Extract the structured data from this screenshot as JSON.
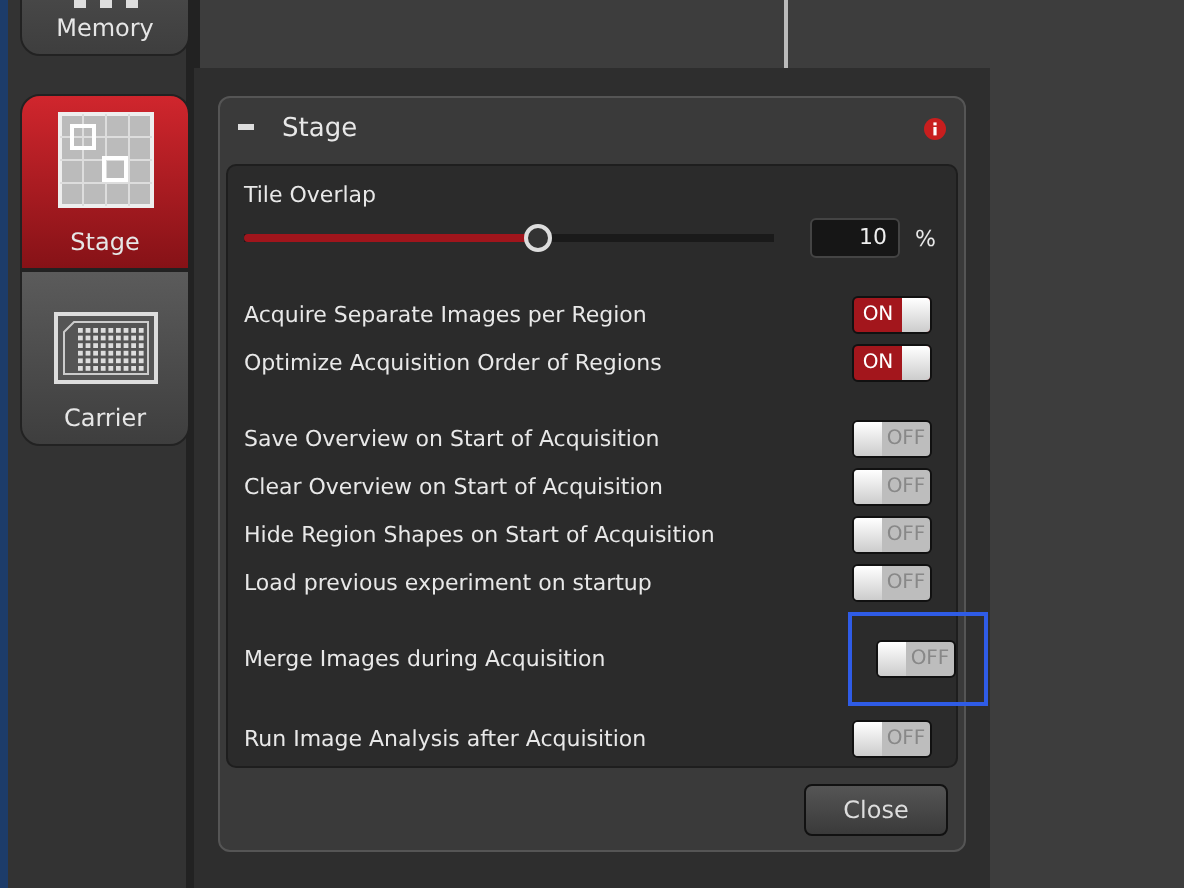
{
  "sidebar": {
    "items": [
      {
        "label": "Memory",
        "selected": false
      },
      {
        "label": "Stage",
        "selected": true
      },
      {
        "label": "Carrier",
        "selected": false
      }
    ]
  },
  "dialog": {
    "title": "Stage",
    "tile_overlap": {
      "label": "Tile Overlap",
      "level": 0.556,
      "value": "10",
      "unit": "%"
    },
    "option_groups": [
      [
        {
          "label": "Acquire Separate Images per Region",
          "on": true,
          "state_text": "ON",
          "highlighted": false
        },
        {
          "label": "Optimize Acquisition Order of Regions",
          "on": true,
          "state_text": "ON",
          "highlighted": false
        }
      ],
      [
        {
          "label": "Save Overview on Start of Acquisition",
          "on": false,
          "state_text": "OFF",
          "highlighted": false
        },
        {
          "label": "Clear Overview on Start of Acquisition",
          "on": false,
          "state_text": "OFF",
          "highlighted": false
        },
        {
          "label": "Hide Region Shapes on Start of Acquisition",
          "on": false,
          "state_text": "OFF",
          "highlighted": false
        },
        {
          "label": "Load previous experiment on startup",
          "on": false,
          "state_text": "OFF",
          "highlighted": false
        }
      ],
      [
        {
          "label": "Merge Images during Acquisition",
          "on": false,
          "state_text": "OFF",
          "highlighted": true
        }
      ],
      [
        {
          "label": "Run Image Analysis after Acquisition",
          "on": false,
          "state_text": "OFF",
          "highlighted": false
        }
      ]
    ],
    "close_button": "Close"
  }
}
